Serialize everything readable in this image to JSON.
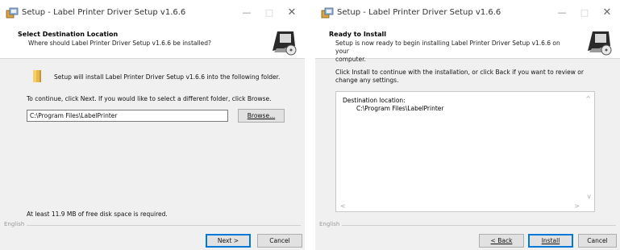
{
  "window1": {
    "title": "Setup - Label Printer Driver Setup v1.6.6",
    "header_title": "Select Destination Location",
    "header_subtitle": "Where should Label Printer Driver Setup v1.6.6 be installed?",
    "install_text": "Setup will install Label Printer Driver Setup v1.6.6 into the following folder.",
    "continue_text": "To continue, click Next. If you would like to select a different folder, click Browse.",
    "path_value": "C:\\Program Files\\LabelPrinter",
    "browse_label": "Browse...",
    "disk_space_text": "At least 11.9 MB of free disk space is required.",
    "language": "English",
    "next_label": "Next >",
    "cancel_label": "Cancel"
  },
  "window2": {
    "title": "Setup - Label Printer Driver Setup v1.6.6",
    "header_title": "Ready to Install",
    "header_subtitle_line1": "Setup is now ready to begin installing Label Printer Driver Setup v1.6.6 on your",
    "header_subtitle_line2": "computer.",
    "instruction_line1": "Click Install to continue with the installation, or click Back if you want to review or",
    "instruction_line2": "change any settings.",
    "memo_label": "Destination location:",
    "memo_value": "C:\\Program Files\\LabelPrinter",
    "language": "English",
    "back_label": "< Back",
    "install_label": "Install",
    "cancel_label": "Cancel"
  },
  "titlebar_controls": {
    "minimize": "—",
    "maximize": "□",
    "close": "✕"
  },
  "colors": {
    "header_bg": "#ffffff",
    "body_bg": "#f0f0f0",
    "default_button_border": "#0078d7"
  }
}
